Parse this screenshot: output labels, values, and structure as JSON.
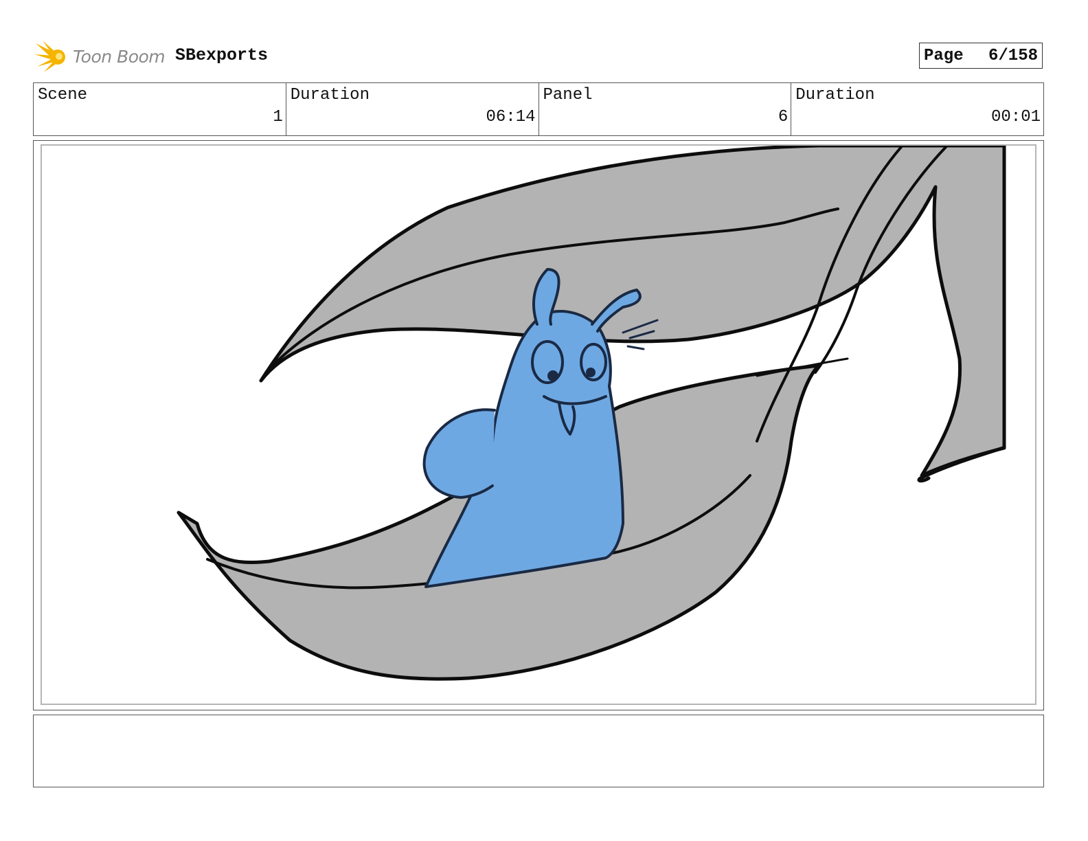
{
  "header": {
    "logo_text": "Toon Boom",
    "project_name": "SBexports",
    "page_label": "Page",
    "page_value": "6/158"
  },
  "info": [
    {
      "label": "Scene",
      "value": "1"
    },
    {
      "label": "Duration",
      "value": "06:14"
    },
    {
      "label": "Panel",
      "value": "6"
    },
    {
      "label": "Duration",
      "value": "00:01"
    }
  ],
  "colors": {
    "leaf_fill": "#b3b3b3",
    "character_fill": "#6ea8e3",
    "line": "#0d0d0d",
    "logo_yellow": "#f5b400"
  },
  "notes": ""
}
